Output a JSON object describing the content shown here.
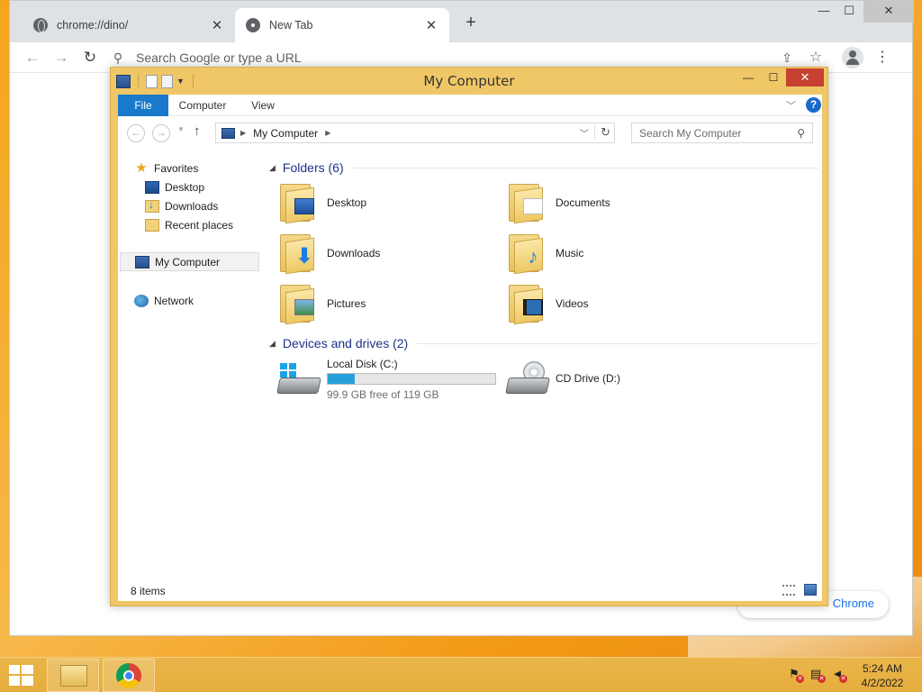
{
  "chrome": {
    "tabs": [
      {
        "title": "chrome://dino/",
        "active": false
      },
      {
        "title": "New Tab",
        "active": true
      }
    ],
    "new_tab_symbol": "+",
    "window_controls": {
      "minimize": "—",
      "maximize": "☐",
      "close": "✕"
    },
    "nav": {
      "back": "←",
      "forward": "→",
      "reload": "↻"
    },
    "omnibox": {
      "placeholder": "Search Google or type a URL"
    },
    "toolbar_icons": [
      "share-icon",
      "star-icon",
      "profile-icon",
      "menu-icon"
    ],
    "promo_text": "Chrome"
  },
  "explorer": {
    "title": "My Computer",
    "window_controls": {
      "minimize": "—",
      "maximize": "☐",
      "close": "✕"
    },
    "ribbon": {
      "tabs": [
        "File",
        "Computer",
        "View"
      ],
      "help": "?"
    },
    "address": {
      "path": "My Computer",
      "search_placeholder": "Search My Computer"
    },
    "nav_pane": {
      "favorites_label": "Favorites",
      "favorites": [
        "Desktop",
        "Downloads",
        "Recent places"
      ],
      "computer_label": "My Computer",
      "network_label": "Network"
    },
    "groups": {
      "folders_header": "Folders (6)",
      "devices_header": "Devices and drives (2)"
    },
    "folders": [
      {
        "name": "Desktop",
        "icon": "desktop-folder-icon"
      },
      {
        "name": "Documents",
        "icon": "documents-folder-icon"
      },
      {
        "name": "Downloads",
        "icon": "downloads-folder-icon"
      },
      {
        "name": "Music",
        "icon": "music-folder-icon"
      },
      {
        "name": "Pictures",
        "icon": "pictures-folder-icon"
      },
      {
        "name": "Videos",
        "icon": "videos-folder-icon"
      }
    ],
    "drives": [
      {
        "name": "Local Disk (C:)",
        "free_text": "99.9 GB free of 119 GB",
        "used_fraction": 0.16
      },
      {
        "name": "CD Drive (D:)"
      }
    ],
    "status": {
      "items": "8 items"
    },
    "colors": {
      "frame": "#f0c766",
      "file_tab": "#1979ca",
      "close": "#c84031",
      "drive_bar": "#26a0da"
    }
  },
  "taskbar": {
    "apps": [
      "file-explorer-icon",
      "chrome-icon"
    ],
    "clock": {
      "time": "5:24 AM",
      "date": "4/2/2022"
    }
  }
}
